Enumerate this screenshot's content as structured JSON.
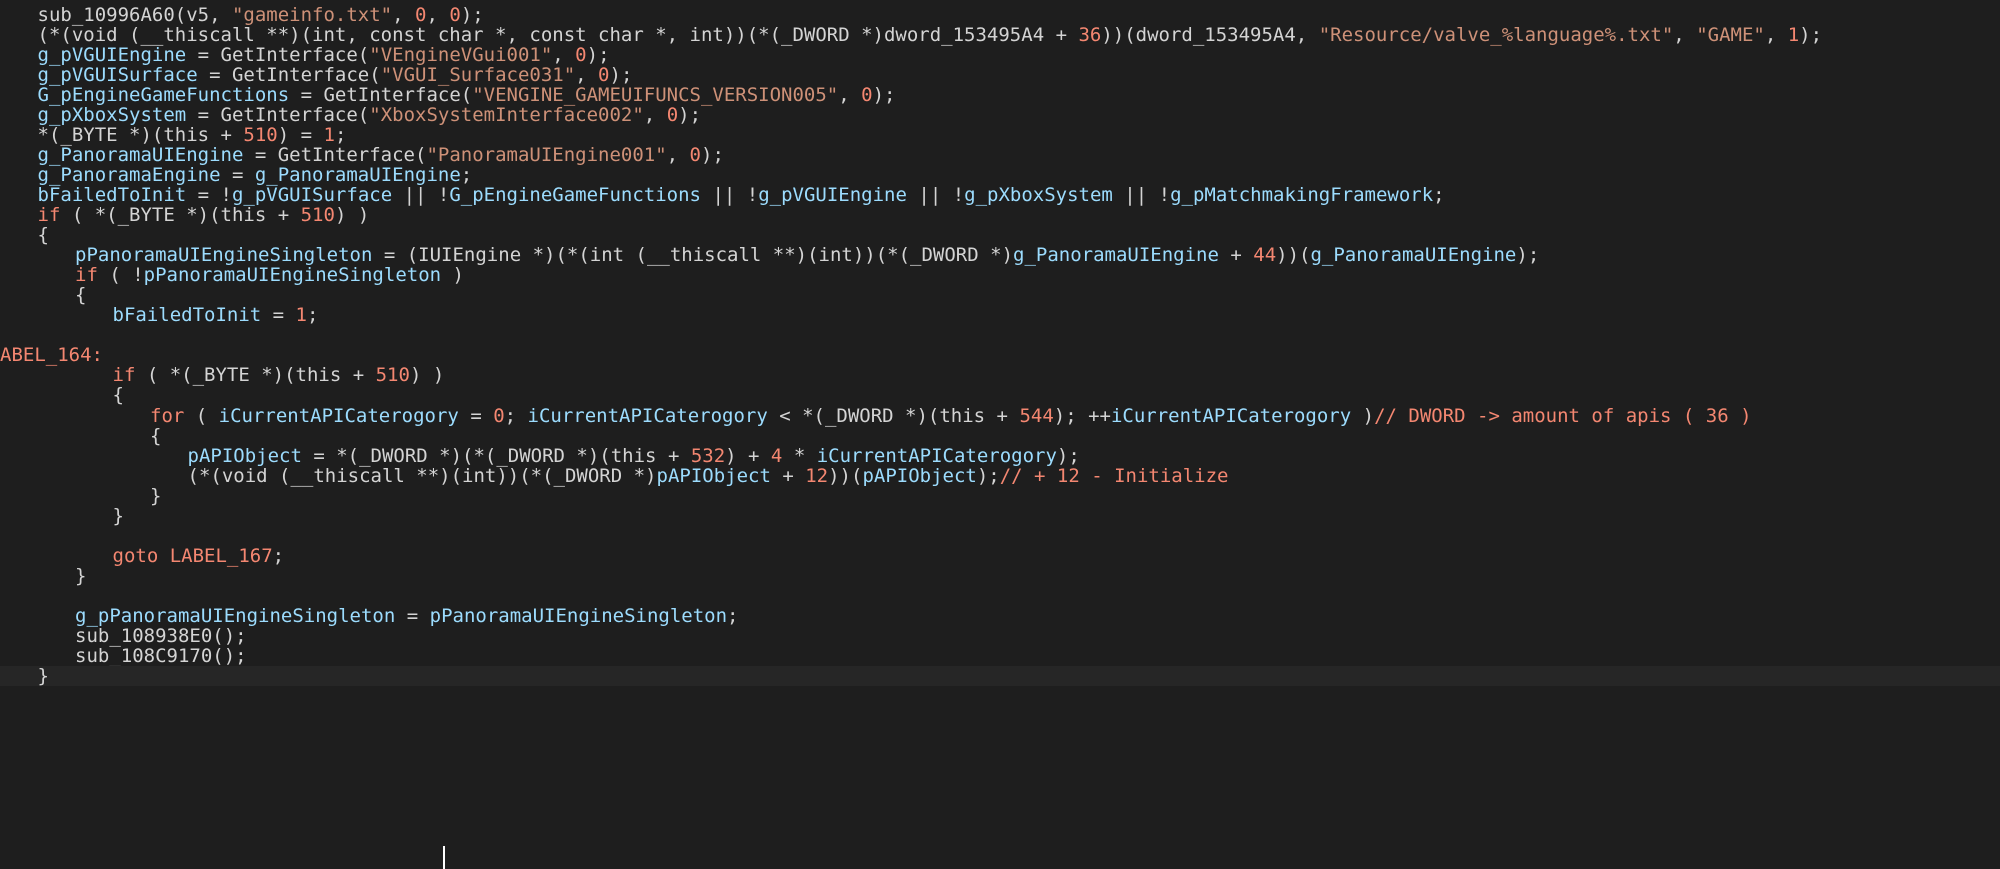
{
  "colors": {
    "background": "#1e1e1e",
    "current_line": "#262626",
    "plain_text": "#d4d4d4",
    "identifier": "#9cdcfe",
    "string": "#ce9178",
    "number_keyword_label": "#f48771"
  },
  "code": {
    "lines": [
      {
        "indent": 1,
        "tokens": [
          {
            "t": "plain",
            "v": "sub_10996A60(v5, "
          },
          {
            "t": "str",
            "v": "\"gameinfo.txt\""
          },
          {
            "t": "plain",
            "v": ", "
          },
          {
            "t": "num",
            "v": "0"
          },
          {
            "t": "plain",
            "v": ", "
          },
          {
            "t": "num",
            "v": "0"
          },
          {
            "t": "plain",
            "v": ");"
          }
        ]
      },
      {
        "indent": 1,
        "tokens": [
          {
            "t": "plain",
            "v": "(*(void (__thiscall **)(int, const char *, const char *, int))(*(_DWORD *)dword_153495A4 + "
          },
          {
            "t": "num",
            "v": "36"
          },
          {
            "t": "plain",
            "v": "))(dword_153495A4, "
          },
          {
            "t": "str",
            "v": "\"Resource/valve_%language%.txt\""
          },
          {
            "t": "plain",
            "v": ", "
          },
          {
            "t": "str",
            "v": "\"GAME\""
          },
          {
            "t": "plain",
            "v": ", "
          },
          {
            "t": "num",
            "v": "1"
          },
          {
            "t": "plain",
            "v": ");"
          }
        ]
      },
      {
        "indent": 1,
        "tokens": [
          {
            "t": "var",
            "v": "g_pVGUIEngine"
          },
          {
            "t": "plain",
            "v": " = GetInterface("
          },
          {
            "t": "str",
            "v": "\"VEngineVGui001\""
          },
          {
            "t": "plain",
            "v": ", "
          },
          {
            "t": "num",
            "v": "0"
          },
          {
            "t": "plain",
            "v": ");"
          }
        ]
      },
      {
        "indent": 1,
        "tokens": [
          {
            "t": "var",
            "v": "g_pVGUISurface"
          },
          {
            "t": "plain",
            "v": " = GetInterface("
          },
          {
            "t": "str",
            "v": "\"VGUI_Surface031\""
          },
          {
            "t": "plain",
            "v": ", "
          },
          {
            "t": "num",
            "v": "0"
          },
          {
            "t": "plain",
            "v": ");"
          }
        ]
      },
      {
        "indent": 1,
        "tokens": [
          {
            "t": "var",
            "v": "G_pEngineGameFunctions"
          },
          {
            "t": "plain",
            "v": " = GetInterface("
          },
          {
            "t": "str",
            "v": "\"VENGINE_GAMEUIFUNCS_VERSION005\""
          },
          {
            "t": "plain",
            "v": ", "
          },
          {
            "t": "num",
            "v": "0"
          },
          {
            "t": "plain",
            "v": ");"
          }
        ]
      },
      {
        "indent": 1,
        "tokens": [
          {
            "t": "var",
            "v": "g_pXboxSystem"
          },
          {
            "t": "plain",
            "v": " = GetInterface("
          },
          {
            "t": "str",
            "v": "\"XboxSystemInterface002\""
          },
          {
            "t": "plain",
            "v": ", "
          },
          {
            "t": "num",
            "v": "0"
          },
          {
            "t": "plain",
            "v": ");"
          }
        ]
      },
      {
        "indent": 1,
        "tokens": [
          {
            "t": "plain",
            "v": "*(_BYTE *)(this + "
          },
          {
            "t": "num",
            "v": "510"
          },
          {
            "t": "plain",
            "v": ") = "
          },
          {
            "t": "num",
            "v": "1"
          },
          {
            "t": "plain",
            "v": ";"
          }
        ]
      },
      {
        "indent": 1,
        "tokens": [
          {
            "t": "var",
            "v": "g_PanoramaUIEngine"
          },
          {
            "t": "plain",
            "v": " = GetInterface("
          },
          {
            "t": "str",
            "v": "\"PanoramaUIEngine001\""
          },
          {
            "t": "plain",
            "v": ", "
          },
          {
            "t": "num",
            "v": "0"
          },
          {
            "t": "plain",
            "v": ");"
          }
        ]
      },
      {
        "indent": 1,
        "tokens": [
          {
            "t": "var",
            "v": "g_PanoramaEngine"
          },
          {
            "t": "plain",
            "v": " = "
          },
          {
            "t": "var",
            "v": "g_PanoramaUIEngine"
          },
          {
            "t": "plain",
            "v": ";"
          }
        ]
      },
      {
        "indent": 1,
        "tokens": [
          {
            "t": "var",
            "v": "bFailedToInit"
          },
          {
            "t": "plain",
            "v": " = !"
          },
          {
            "t": "var",
            "v": "g_pVGUISurface"
          },
          {
            "t": "plain",
            "v": " || !"
          },
          {
            "t": "var",
            "v": "G_pEngineGameFunctions"
          },
          {
            "t": "plain",
            "v": " || !"
          },
          {
            "t": "var",
            "v": "g_pVGUIEngine"
          },
          {
            "t": "plain",
            "v": " || !"
          },
          {
            "t": "var",
            "v": "g_pXboxSystem"
          },
          {
            "t": "plain",
            "v": " || !"
          },
          {
            "t": "var",
            "v": "g_pMatchmakingFramework"
          },
          {
            "t": "plain",
            "v": ";"
          }
        ]
      },
      {
        "indent": 1,
        "tokens": [
          {
            "t": "kw",
            "v": "if"
          },
          {
            "t": "plain",
            "v": " ( *(_BYTE *)(this + "
          },
          {
            "t": "num",
            "v": "510"
          },
          {
            "t": "plain",
            "v": ") )"
          }
        ]
      },
      {
        "indent": 1,
        "tokens": [
          {
            "t": "plain",
            "v": "{"
          }
        ]
      },
      {
        "indent": 2,
        "tokens": [
          {
            "t": "var",
            "v": "pPanoramaUIEngineSingleton"
          },
          {
            "t": "plain",
            "v": " = (IUIEngine *)(*(int (__thiscall **)(int))(*(_DWORD *)"
          },
          {
            "t": "var",
            "v": "g_PanoramaUIEngine"
          },
          {
            "t": "plain",
            "v": " + "
          },
          {
            "t": "num",
            "v": "44"
          },
          {
            "t": "plain",
            "v": "))("
          },
          {
            "t": "var",
            "v": "g_PanoramaUIEngine"
          },
          {
            "t": "plain",
            "v": ");"
          }
        ]
      },
      {
        "indent": 2,
        "tokens": [
          {
            "t": "kw",
            "v": "if"
          },
          {
            "t": "plain",
            "v": " ( !"
          },
          {
            "t": "var",
            "v": "pPanoramaUIEngineSingleton"
          },
          {
            "t": "plain",
            "v": " )"
          }
        ]
      },
      {
        "indent": 2,
        "tokens": [
          {
            "t": "plain",
            "v": "{"
          }
        ]
      },
      {
        "indent": 3,
        "tokens": [
          {
            "t": "var",
            "v": "bFailedToInit"
          },
          {
            "t": "plain",
            "v": " = "
          },
          {
            "t": "num",
            "v": "1"
          },
          {
            "t": "plain",
            "v": ";"
          }
        ]
      },
      {
        "indent": 0,
        "tokens": []
      },
      {
        "indent": 0,
        "tokens": [
          {
            "t": "label",
            "v": "ABEL_164:"
          }
        ]
      },
      {
        "indent": 3,
        "tokens": [
          {
            "t": "kw",
            "v": "if"
          },
          {
            "t": "plain",
            "v": " ( *(_BYTE *)(this + "
          },
          {
            "t": "num",
            "v": "510"
          },
          {
            "t": "plain",
            "v": ") )"
          }
        ]
      },
      {
        "indent": 3,
        "tokens": [
          {
            "t": "plain",
            "v": "{"
          }
        ]
      },
      {
        "indent": 4,
        "tokens": [
          {
            "t": "kw",
            "v": "for"
          },
          {
            "t": "plain",
            "v": " ( "
          },
          {
            "t": "var",
            "v": "iCurrentAPICaterogory"
          },
          {
            "t": "plain",
            "v": " = "
          },
          {
            "t": "num",
            "v": "0"
          },
          {
            "t": "plain",
            "v": "; "
          },
          {
            "t": "var",
            "v": "iCurrentAPICaterogory"
          },
          {
            "t": "plain",
            "v": " < *(_DWORD *)(this + "
          },
          {
            "t": "num",
            "v": "544"
          },
          {
            "t": "plain",
            "v": "); ++"
          },
          {
            "t": "var",
            "v": "iCurrentAPICaterogory"
          },
          {
            "t": "plain",
            "v": " )"
          },
          {
            "t": "comment",
            "v": "// DWORD -> amount of apis ( 36 )"
          }
        ]
      },
      {
        "indent": 4,
        "tokens": [
          {
            "t": "plain",
            "v": "{"
          }
        ]
      },
      {
        "indent": 5,
        "tokens": [
          {
            "t": "var",
            "v": "pAPIObject"
          },
          {
            "t": "plain",
            "v": " = *(_DWORD *)(*(_DWORD *)(this + "
          },
          {
            "t": "num",
            "v": "532"
          },
          {
            "t": "plain",
            "v": ") + "
          },
          {
            "t": "num",
            "v": "4"
          },
          {
            "t": "plain",
            "v": " * "
          },
          {
            "t": "var",
            "v": "iCurrentAPICaterogory"
          },
          {
            "t": "plain",
            "v": ");"
          }
        ]
      },
      {
        "indent": 5,
        "tokens": [
          {
            "t": "plain",
            "v": "(*(void (__thiscall **)(int))(*(_DWORD *)"
          },
          {
            "t": "var",
            "v": "pAPIObject"
          },
          {
            "t": "plain",
            "v": " + "
          },
          {
            "t": "num",
            "v": "12"
          },
          {
            "t": "plain",
            "v": "))("
          },
          {
            "t": "var",
            "v": "pAPIObject"
          },
          {
            "t": "plain",
            "v": ");"
          },
          {
            "t": "comment",
            "v": "// + 12 - Initialize"
          }
        ]
      },
      {
        "indent": 4,
        "tokens": [
          {
            "t": "plain",
            "v": "}"
          }
        ]
      },
      {
        "indent": 3,
        "tokens": [
          {
            "t": "plain",
            "v": "}"
          }
        ]
      },
      {
        "indent": 0,
        "tokens": []
      },
      {
        "indent": 3,
        "tokens": [
          {
            "t": "kw",
            "v": "goto"
          },
          {
            "t": "plain",
            "v": " "
          },
          {
            "t": "label",
            "v": "LABEL_167"
          },
          {
            "t": "plain",
            "v": ";"
          }
        ]
      },
      {
        "indent": 2,
        "tokens": [
          {
            "t": "plain",
            "v": "}"
          }
        ]
      },
      {
        "indent": 0,
        "tokens": []
      },
      {
        "indent": 2,
        "tokens": [
          {
            "t": "var",
            "v": "g_pPanoramaUIEngineSingleton"
          },
          {
            "t": "plain",
            "v": " = "
          },
          {
            "t": "var",
            "v": "pPanoramaUIEngineSingleton"
          },
          {
            "t": "plain",
            "v": ";"
          }
        ]
      },
      {
        "indent": 2,
        "tokens": [
          {
            "t": "plain",
            "v": "sub_108938E0();"
          }
        ]
      },
      {
        "indent": 2,
        "tokens": [
          {
            "t": "plain",
            "v": "sub_108C9170();"
          }
        ]
      },
      {
        "indent": 1,
        "current": true,
        "tokens": [
          {
            "t": "plain",
            "v": "}"
          }
        ]
      }
    ]
  }
}
